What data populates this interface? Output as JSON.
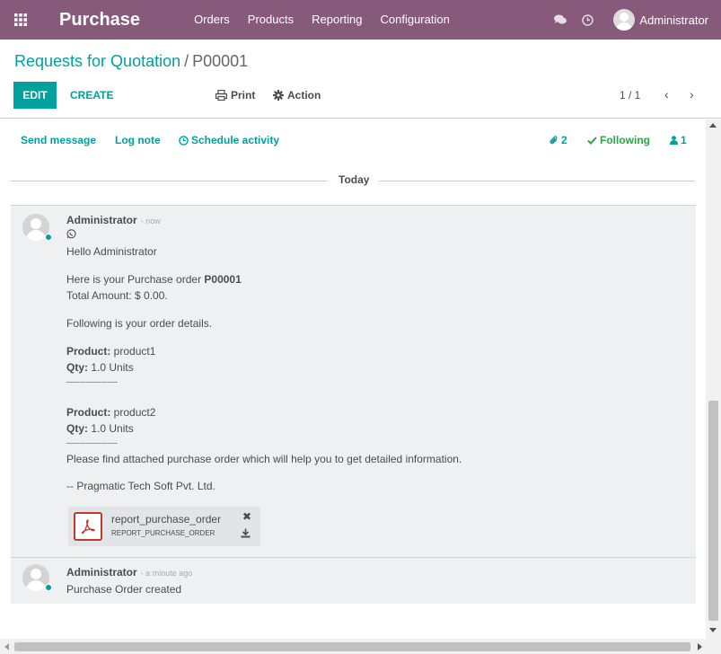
{
  "topbar": {
    "app_name": "Purchase",
    "menu": [
      "Orders",
      "Products",
      "Reporting",
      "Configuration"
    ],
    "user_name": "Administrator",
    "color": "#875a7b"
  },
  "control_panel": {
    "breadcrumb_parent": "Requests for Quotation",
    "breadcrumb_separator": "/",
    "breadcrumb_current": "P00001",
    "edit_label": "EDIT",
    "create_label": "CREATE",
    "print_label": "Print",
    "action_label": "Action",
    "pager": "1 / 1",
    "accent": "#00a09d"
  },
  "chatter": {
    "send_message": "Send message",
    "log_note": "Log note",
    "schedule_activity": "Schedule activity",
    "attachment_count": "2",
    "following_label": "Following",
    "follower_count": "1",
    "date_separator": "Today"
  },
  "messages": [
    {
      "author": "Administrator",
      "date": "- now",
      "lines": {
        "greeting": "Hello Administrator",
        "intro_prefix": "Here is your Purchase order ",
        "intro_ref": "P00001",
        "total": "Total Amount: $ 0.00.",
        "details": "Following is your order details.",
        "product_label": "Product:",
        "qty_label": "Qty:",
        "product1": " product1",
        "qty1": " 1.0 Units",
        "divider": "-------------------",
        "product2": " product2",
        "qty2": " 1.0 Units",
        "closing": "Please find attached purchase order which will help you to get detailed information.",
        "signature": "-- Pragmatic Tech Soft Pvt. Ltd."
      },
      "attachment": {
        "name": "report_purchase_order",
        "ext": "REPORT_PURCHASE_ORDER"
      }
    },
    {
      "author": "Administrator",
      "date": "- a minute ago",
      "body": "Purchase Order created"
    }
  ]
}
